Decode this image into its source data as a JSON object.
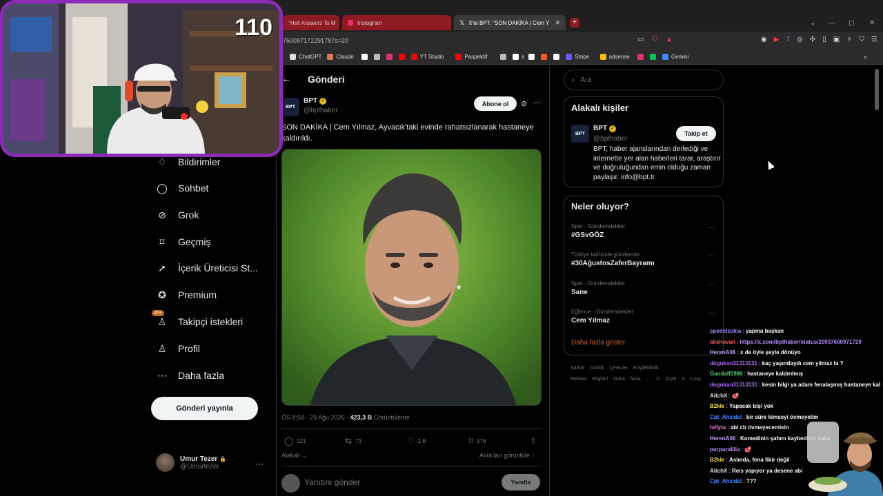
{
  "browser": {
    "tabs": [
      {
        "label": "\"Hell Answers To M",
        "style": "red"
      },
      {
        "label": "Instagram",
        "style": "red"
      },
      {
        "label": "X'te BPT: \"SON DAKİKA | Cem Yıl",
        "style": "active"
      }
    ],
    "url": "760097172291787s=20",
    "bookmarks": [
      {
        "label": "ChatGPT",
        "color": "#dddddd"
      },
      {
        "label": "Claude",
        "color": "#d97757"
      },
      {
        "label": "",
        "color": "#ffffff"
      },
      {
        "label": "",
        "color": "#bbbbbb"
      },
      {
        "label": "",
        "color": "#e1306c"
      },
      {
        "label": "",
        "color": "#ff0000"
      },
      {
        "label": "YT Studio",
        "color": "#ff0000"
      },
      {
        "label": "Paspektif",
        "color": "#ff0000"
      },
      {
        "label": "",
        "color": "#bbbbbb"
      },
      {
        "label": "s",
        "color": "#ffffff"
      },
      {
        "label": "",
        "color": "#ffffff"
      },
      {
        "label": "",
        "color": "#ff5722"
      },
      {
        "label": "",
        "color": "#ffffff"
      },
      {
        "label": "Stripe",
        "color": "#635bff"
      },
      {
        "label": "adsense",
        "color": "#fbbc04"
      },
      {
        "label": "",
        "color": "#e1306c"
      },
      {
        "label": "",
        "color": "#00c853"
      },
      {
        "label": "Gemini",
        "color": "#4285f4"
      }
    ]
  },
  "stream": {
    "viewer_count": "110"
  },
  "nav": {
    "items": [
      {
        "label": "Bildirimler",
        "icon": "bell-icon",
        "glyph": "♢"
      },
      {
        "label": "Sohbet",
        "icon": "chat-icon",
        "glyph": "◯"
      },
      {
        "label": "Grok",
        "icon": "grok-icon",
        "glyph": "⊘"
      },
      {
        "label": "Geçmiş",
        "icon": "bookmark-icon",
        "glyph": "⌑"
      },
      {
        "label": "İçerik Üreticisi St...",
        "icon": "rocket-icon",
        "glyph": "➚"
      },
      {
        "label": "Premium",
        "icon": "premium-icon",
        "glyph": "✪"
      },
      {
        "label": "Takipçi istekleri",
        "icon": "follow-requests-icon",
        "glyph": "♙",
        "badge": "20+"
      },
      {
        "label": "Profil",
        "icon": "profile-icon",
        "glyph": "♙"
      },
      {
        "label": "Daha fazla",
        "icon": "more-circle-icon",
        "glyph": "⋯"
      }
    ],
    "post_button": "Gönderi yayınla",
    "account": {
      "name": "Umur Tezer",
      "handle": "@Umurtezer"
    }
  },
  "post": {
    "header": "Gönderi",
    "author": {
      "name": "BPT",
      "handle": "@bpthaber",
      "avatar_text": "BPT"
    },
    "subscribe_label": "Abone ol",
    "text": "SON DAKİKA | Cem Yılmaz, Ayvacık'taki evinde rahatsızlanarak hastaneye kaldırıldı.",
    "meta": {
      "time": "ÖS 8:58 · 29 Ağu 2026 · ",
      "views": "423,3 B",
      "views_label": " Görüntüleme"
    },
    "stats": {
      "replies": "121",
      "reposts": "73",
      "likes": "2 B",
      "bookmarks": "176"
    },
    "relevant_label": "Alakalı",
    "quotes_label": "Alıntıları görüntüle",
    "reply_placeholder": "Yanıtını gönder",
    "reply_button": "Yanıtla"
  },
  "sidebar": {
    "search_placeholder": "Ara",
    "related": {
      "title": "Alakalı kişiler",
      "name": "BPT",
      "handle": "@bpthaber",
      "follow_label": "Takip et",
      "bio": "BPT, haber ajanslarından derlediği ve internette yer alan haberleri tarar, araştırır ve doğruluğundan emin olduğu zaman paylaşır. info@bpt.tr"
    },
    "trends": {
      "title": "Neler oluyor?",
      "items": [
        {
          "category": "Spor · Gündemdekiler",
          "name": "#GSvGÖZ"
        },
        {
          "category": "Türkiye tarihinde gündemde",
          "name": "#30AğustosZaferBayramı"
        },
        {
          "category": "Spor · Gündemdekiler",
          "name": "Sane"
        },
        {
          "category": "Eğlence · Gündemdekiler",
          "name": "Cem Yılmaz"
        }
      ],
      "show_more": "Daha fazla göster"
    },
    "footer": [
      "Şartlar Gizlilik Çerezler Erişilebilirlik",
      "Reklam Bilgileri Daha fazla ··· © 2026 X Corp."
    ]
  },
  "chat": [
    {
      "user": "spedelzokia",
      "color": "#9b8cff",
      "msg": "yapma başkan"
    },
    {
      "user": "alishovali",
      "color": "#ff5c5c",
      "msg": "https://x.com/bpthaber/status/20937600971729",
      "msg_color": "#b98cff"
    },
    {
      "user": "HerenA06",
      "color": "#c9a0ff",
      "msg": "x de öyle şeyle dönüyo"
    },
    {
      "user": "dogukan31313131",
      "color": "#b46cff",
      "msg": "kaç yaşındaydı cem yılmaz la ?"
    },
    {
      "user": "Gandalf1986",
      "color": "#4fd16b",
      "msg": "hastaneye kaldırılmış"
    },
    {
      "user": "dogukan31313131",
      "color": "#b46cff",
      "msg": "kesin bilgi ya adam fenalaşmış hastaneye kal"
    },
    {
      "user": "AitchX",
      "color": "#e0e0e0",
      "msg": "🥩"
    },
    {
      "user": "B2kle",
      "color": "#f5e04a",
      "msg": "Yapacak bişi yok"
    },
    {
      "user": "Cpt_Ahzidal",
      "color": "#4a8cff",
      "msg": "bir süre kimseyi övmeyelim"
    },
    {
      "user": "lollyta",
      "color": "#ff7ad9",
      "msg": "abi cb övmeyecemisin"
    },
    {
      "user": "HerenA06",
      "color": "#c9a0ff",
      "msg": "Komedinin şahını kaybederiz valla"
    },
    {
      "user": "purpuralilia",
      "color": "#c08cff",
      "msg": "🥩"
    },
    {
      "user": "B2kle",
      "color": "#f5e04a",
      "msg": "Aslında, fena fikir değil"
    },
    {
      "user": "AitchX",
      "color": "#e0e0e0",
      "msg": "Reis yapıyor ya desene abi"
    },
    {
      "user": "Cpt_Ahzidal",
      "color": "#4a8cff",
      "msg": "???"
    }
  ]
}
